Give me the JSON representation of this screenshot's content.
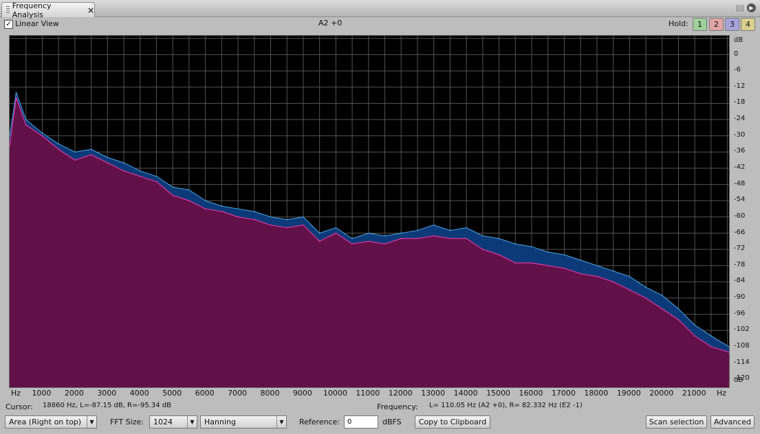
{
  "panel": {
    "tab_title": "Frequency Analysis"
  },
  "top": {
    "linear_view_label": "Linear View",
    "linear_view_checked": true,
    "note": "A2 +0",
    "hold_label": "Hold:",
    "hold_buttons": [
      {
        "label": "1",
        "color": "#9fcf9a"
      },
      {
        "label": "2",
        "color": "#e0a5a5"
      },
      {
        "label": "3",
        "color": "#a9a2d9"
      },
      {
        "label": "4",
        "color": "#d9cf8d"
      }
    ]
  },
  "chart_data": {
    "type": "area",
    "xlabel": "Hz",
    "ylabel": "dB",
    "x_unit_label": "Hz",
    "xlim": [
      0,
      22050
    ],
    "ylim": [
      -123,
      7
    ],
    "x_ticks": [
      1000,
      2000,
      3000,
      4000,
      5000,
      6000,
      7000,
      8000,
      9000,
      10000,
      11000,
      12000,
      13000,
      14000,
      15000,
      16000,
      17000,
      18000,
      19000,
      20000,
      21000
    ],
    "y_ticks": [
      0,
      -6,
      -12,
      -18,
      -24,
      -30,
      -36,
      -42,
      -48,
      -54,
      -60,
      -66,
      -72,
      -78,
      -84,
      -90,
      -96,
      -102,
      -108,
      -114,
      -120
    ],
    "grid": true,
    "background": "#000000",
    "series": [
      {
        "color": "#0c3a78",
        "line_color": "#4aa6e8",
        "x": [
          0,
          200,
          500,
          1000,
          1500,
          2000,
          2500,
          3000,
          3500,
          4000,
          4500,
          5000,
          5500,
          6000,
          6500,
          7000,
          7500,
          8000,
          8500,
          9000,
          9500,
          10000,
          10500,
          11000,
          11500,
          12000,
          12500,
          13000,
          13500,
          14000,
          14500,
          15000,
          15500,
          16000,
          16500,
          17000,
          17500,
          18000,
          18500,
          19000,
          19500,
          20000,
          20500,
          21000,
          21500,
          22050
        ],
        "values": [
          -30,
          -14,
          -24,
          -29,
          -33,
          -36,
          -35,
          -38,
          -40,
          -43,
          -45,
          -49,
          -50,
          -54,
          -56,
          -57,
          -58,
          -60,
          -61,
          -60,
          -66,
          -64,
          -68,
          -66,
          -67,
          -66,
          -65,
          -63,
          -65,
          -64,
          -67,
          -68,
          -70,
          -71,
          -73,
          -74,
          -76,
          -78,
          -80,
          -82,
          -86,
          -89,
          -94,
          -100,
          -104,
          -108
        ]
      },
      {
        "color": "#621148",
        "line_color": "#ff38b0",
        "x": [
          0,
          200,
          500,
          1000,
          1500,
          2000,
          2500,
          3000,
          3500,
          4000,
          4500,
          5000,
          5500,
          6000,
          6500,
          7000,
          7500,
          8000,
          8500,
          9000,
          9500,
          10000,
          10500,
          11000,
          11500,
          12000,
          12500,
          13000,
          13500,
          14000,
          14500,
          15000,
          15500,
          16000,
          16500,
          17000,
          17500,
          18000,
          18500,
          19000,
          19500,
          20000,
          20500,
          21000,
          21500,
          22050
        ],
        "values": [
          -34,
          -16,
          -26,
          -30,
          -35,
          -39,
          -37,
          -40,
          -43,
          -45,
          -47,
          -52,
          -54,
          -57,
          -58,
          -60,
          -61,
          -63,
          -64,
          -63,
          -69,
          -66,
          -70,
          -69,
          -70,
          -68,
          -68,
          -67,
          -68,
          -68,
          -72,
          -74,
          -77,
          -77,
          -78,
          -79,
          -81,
          -82,
          -84,
          -87,
          -90,
          -94,
          -98,
          -104,
          -108,
          -110
        ]
      }
    ]
  },
  "status": {
    "cursor_label": "Cursor:",
    "cursor_value": "18860 Hz, L=-87.15 dB, R=-95.34 dB",
    "frequency_label": "Frequency:",
    "frequency_value": "L= 110.05 Hz (A2 +0), R= 82.332 Hz (E2 -1)"
  },
  "bottom": {
    "view_mode": "Area (Right on top)",
    "fft_label": "FFT Size:",
    "fft_size": "1024",
    "window": "Hanning",
    "reference_label": "Reference:",
    "reference_value": "0",
    "dbfs_label": "dBFS",
    "copy_button": "Copy to Clipboard",
    "scan_button": "Scan selection",
    "advanced_button": "Advanced"
  }
}
